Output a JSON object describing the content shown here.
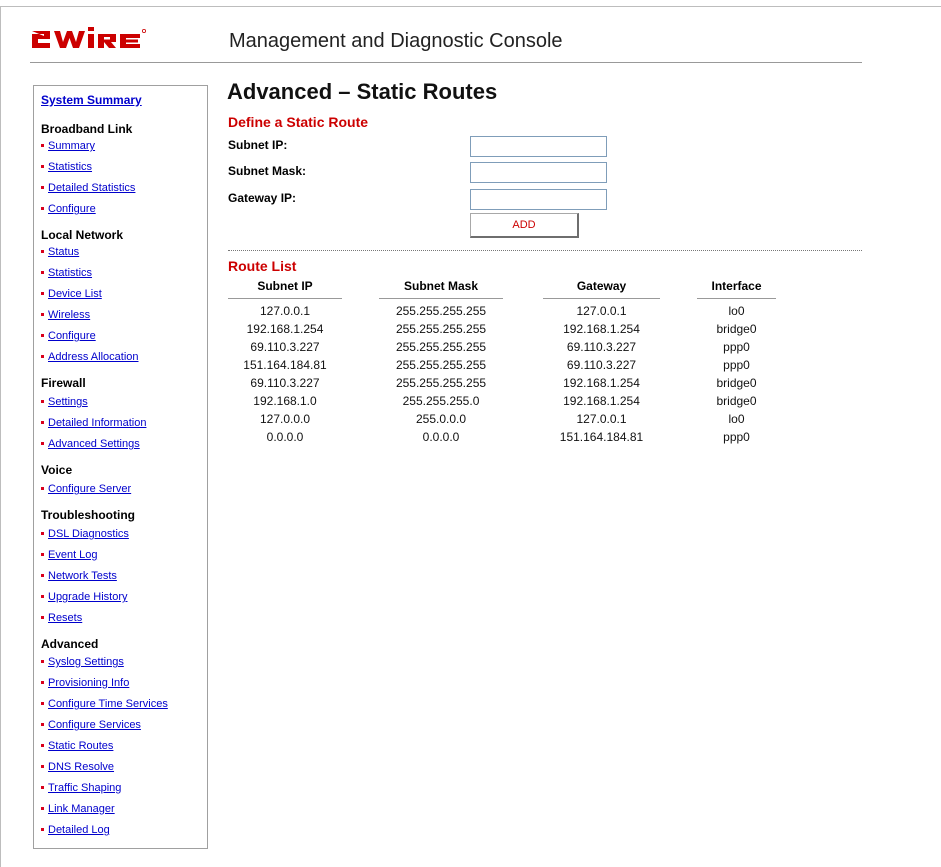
{
  "brand": {
    "logo_text": "2WIRE",
    "logo_color": "#cc0000"
  },
  "header": {
    "title": "Management and Diagnostic Console"
  },
  "sidebar": {
    "summary_label": "System Summary",
    "sections": [
      {
        "heading": "Broadband Link",
        "links": [
          "Summary",
          "Statistics",
          "Detailed Statistics",
          "Configure"
        ]
      },
      {
        "heading": "Local Network",
        "links": [
          "Status",
          "Statistics",
          "Device List",
          "Wireless",
          "Configure",
          "Address Allocation"
        ]
      },
      {
        "heading": "Firewall",
        "links": [
          "Settings",
          "Detailed Information",
          "Advanced Settings"
        ]
      },
      {
        "heading": "Voice",
        "links": [
          "Configure Server"
        ]
      },
      {
        "heading": "Troubleshooting",
        "links": [
          "DSL Diagnostics",
          "Event Log",
          "Network Tests",
          "Upgrade History",
          "Resets"
        ]
      },
      {
        "heading": "Advanced",
        "links": [
          "Syslog Settings",
          "Provisioning Info",
          "Configure Time Services",
          "Configure Services",
          "Static Routes",
          "DNS Resolve",
          "Traffic Shaping",
          "Link Manager",
          "Detailed Log"
        ]
      }
    ]
  },
  "main": {
    "page_title": "Advanced – Static Routes",
    "define_title": "Define a Static Route",
    "form": {
      "subnet_ip_label": "Subnet IP:",
      "subnet_ip_value": "",
      "subnet_mask_label": "Subnet Mask:",
      "subnet_mask_value": "",
      "gateway_ip_label": "Gateway IP:",
      "gateway_ip_value": "",
      "add_label": "ADD"
    },
    "route_list_title": "Route List",
    "columns": [
      "Subnet IP",
      "Subnet Mask",
      "Gateway",
      "Interface"
    ],
    "routes": [
      [
        "127.0.0.1",
        "255.255.255.255",
        "127.0.0.1",
        "lo0"
      ],
      [
        "192.168.1.254",
        "255.255.255.255",
        "192.168.1.254",
        "bridge0"
      ],
      [
        "69.110.3.227",
        "255.255.255.255",
        "69.110.3.227",
        "ppp0"
      ],
      [
        "151.164.184.81",
        "255.255.255.255",
        "69.110.3.227",
        "ppp0"
      ],
      [
        "69.110.3.227",
        "255.255.255.255",
        "192.168.1.254",
        "bridge0"
      ],
      [
        "192.168.1.0",
        "255.255.255.0",
        "192.168.1.254",
        "bridge0"
      ],
      [
        "127.0.0.0",
        "255.0.0.0",
        "127.0.0.1",
        "lo0"
      ],
      [
        "0.0.0.0",
        "0.0.0.0",
        "151.164.184.81",
        "ppp0"
      ]
    ]
  },
  "colors": {
    "accent_red": "#cc0000",
    "link_blue": "#0000cc",
    "bullet_red": "#d9001b"
  }
}
